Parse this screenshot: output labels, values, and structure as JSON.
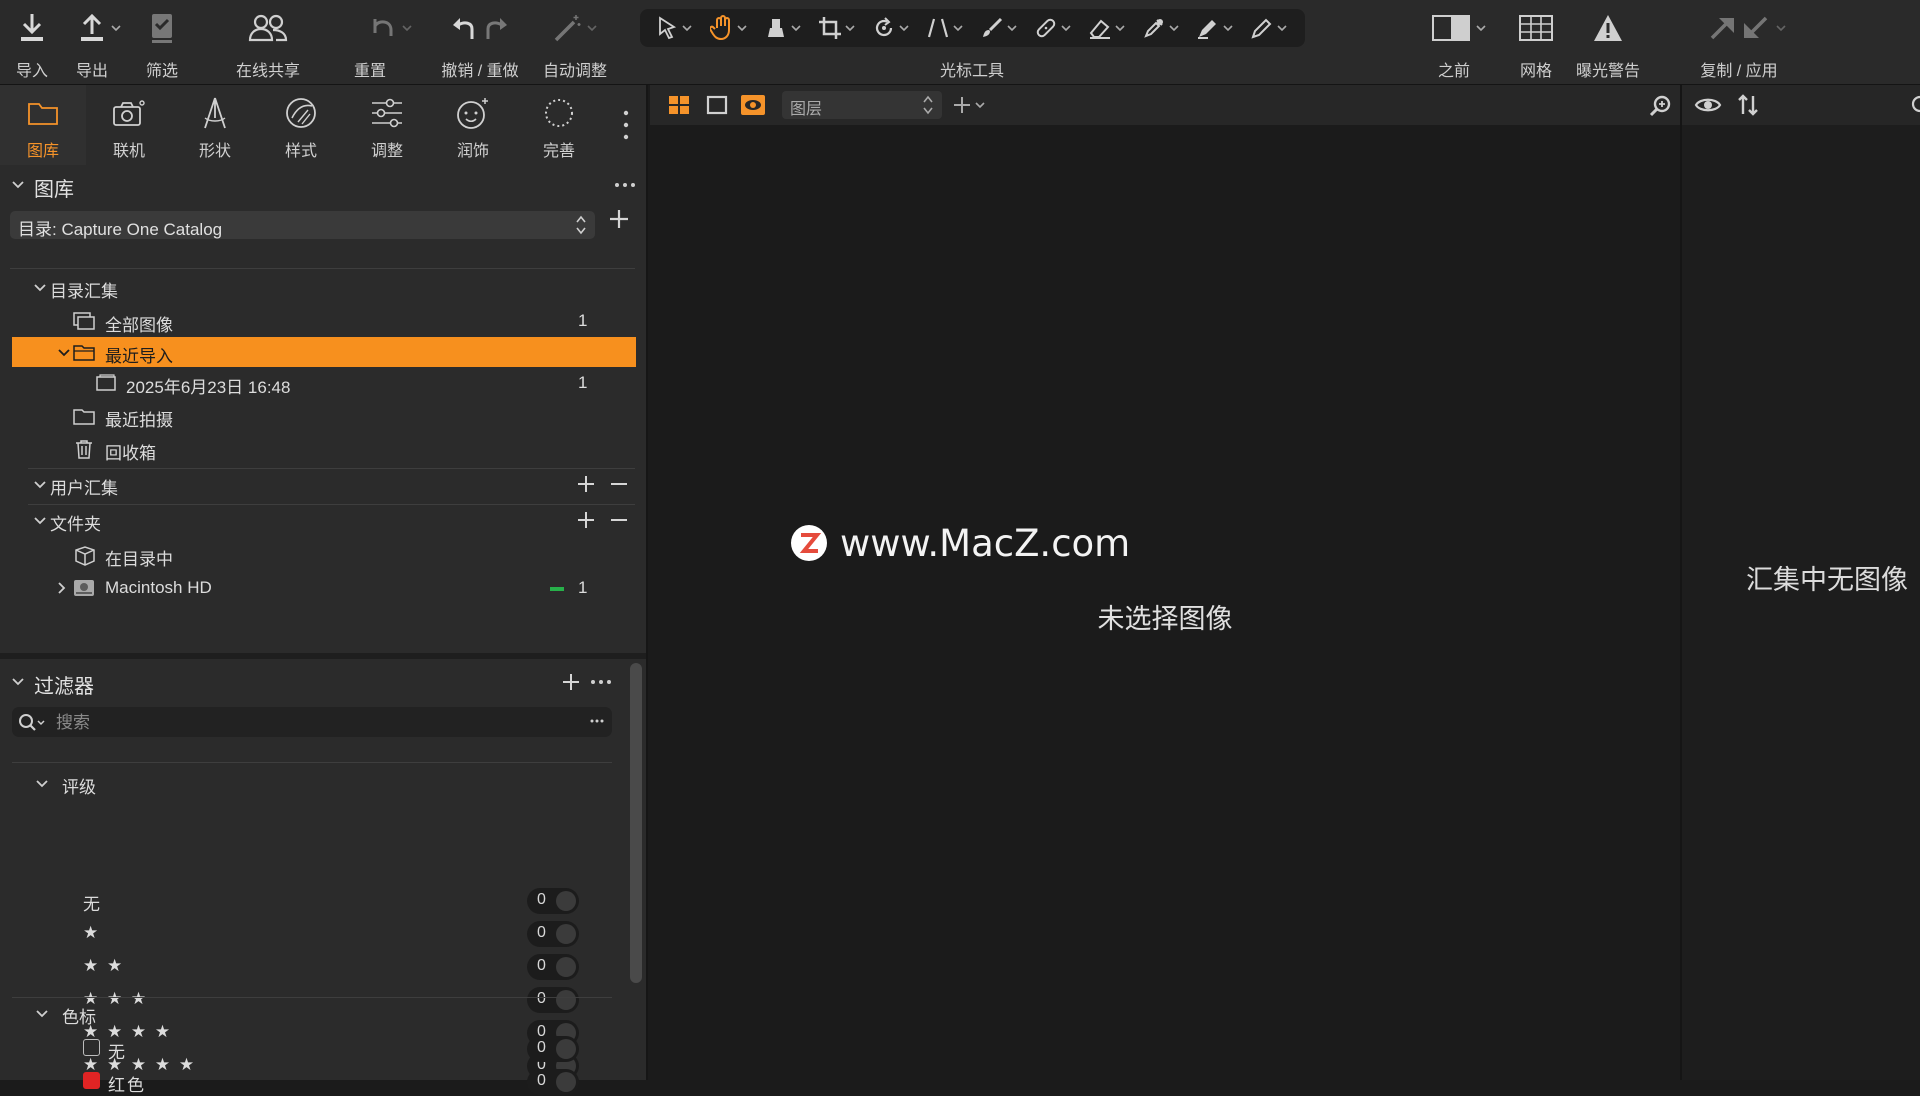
{
  "toolbar": {
    "import": "导入",
    "export": "导出",
    "filter": "筛选",
    "share": "在线共享",
    "reset": "重置",
    "undo_redo": "撤销 / 重做",
    "auto_adjust": "自动调整",
    "cursor_tools": "光标工具",
    "before": "之前",
    "grid": "网格",
    "exposure_warning": "曝光警告",
    "copy_apply": "复制 / 应用"
  },
  "tool_tabs": [
    "图库",
    "联机",
    "形状",
    "样式",
    "调整",
    "润饰",
    "完善"
  ],
  "library": {
    "title": "图库",
    "catalog": "目录: Capture One Catalog",
    "catalog_collections": {
      "title": "目录汇集",
      "items": [
        {
          "label": "全部图像",
          "count": "1"
        },
        {
          "label": "最近导入",
          "count": ""
        },
        {
          "label": "2025年6月23日 16:48",
          "count": "1"
        },
        {
          "label": "最近拍摄",
          "count": ""
        },
        {
          "label": "回收箱",
          "count": ""
        }
      ]
    },
    "user_collections": "用户汇集",
    "folders": {
      "title": "文件夹",
      "items": [
        {
          "label": "在目录中",
          "count": ""
        },
        {
          "label": "Macintosh HD",
          "count": "1"
        }
      ]
    }
  },
  "filters": {
    "title": "过滤器",
    "search_placeholder": "搜索",
    "rating": {
      "title": "评级",
      "items": [
        {
          "label": "无",
          "count": "0"
        },
        {
          "label": "★",
          "count": "0"
        },
        {
          "label": "★ ★",
          "count": "0"
        },
        {
          "label": "★ ★ ★",
          "count": "0"
        },
        {
          "label": "★ ★ ★ ★",
          "count": "0"
        },
        {
          "label": "★ ★ ★ ★ ★",
          "count": "0"
        }
      ]
    },
    "color_tag": {
      "title": "色标",
      "items": [
        {
          "label": "无",
          "count": "0"
        },
        {
          "label": "红色",
          "count": "0"
        }
      ]
    }
  },
  "viewer": {
    "layer_select": "图层",
    "watermark": "www.MacZ.com",
    "no_image": "未选择图像"
  },
  "browser": {
    "no_images": "汇集中无图像"
  },
  "colors": {
    "accent": "#f7901e",
    "panel": "#2b2b2b",
    "background": "#1b1b1b",
    "status_green": "#27b04a"
  }
}
